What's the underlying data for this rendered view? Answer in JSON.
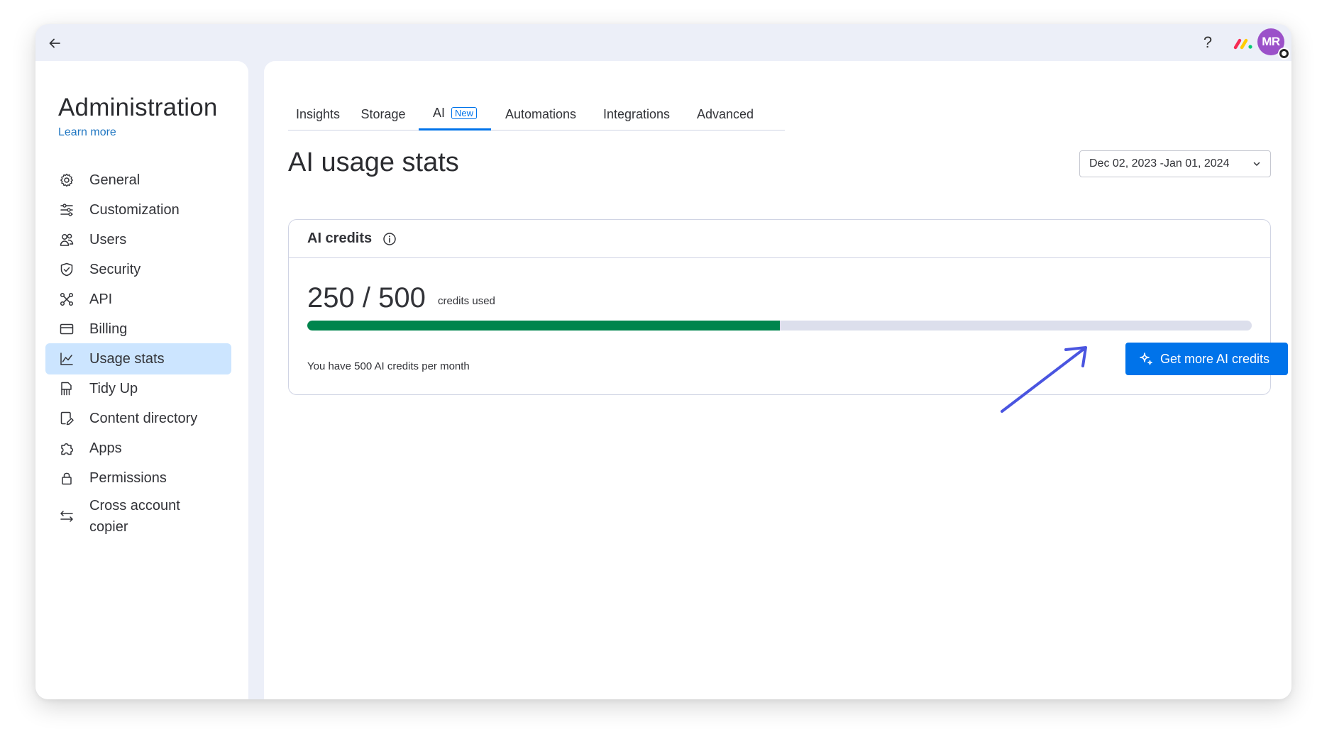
{
  "topbar": {
    "help_label": "?",
    "avatar_initials": "MR",
    "avatar_color": "#9b51c9"
  },
  "sidebar": {
    "title": "Administration",
    "learn_more": "Learn more",
    "items": [
      {
        "label": "General",
        "icon": "gear-icon"
      },
      {
        "label": "Customization",
        "icon": "sliders-icon"
      },
      {
        "label": "Users",
        "icon": "users-icon"
      },
      {
        "label": "Security",
        "icon": "shield-icon"
      },
      {
        "label": "API",
        "icon": "api-icon"
      },
      {
        "label": "Billing",
        "icon": "credit-card-icon"
      },
      {
        "label": "Usage stats",
        "icon": "chart-icon",
        "active": true
      },
      {
        "label": "Tidy Up",
        "icon": "broom-icon"
      },
      {
        "label": "Content directory",
        "icon": "document-edit-icon"
      },
      {
        "label": "Apps",
        "icon": "puzzle-icon"
      },
      {
        "label": "Permissions",
        "icon": "lock-icon"
      },
      {
        "label": "Cross account",
        "label_line2": "copier",
        "icon": "swap-arrows-icon"
      }
    ]
  },
  "tabs": [
    {
      "label": "Insights"
    },
    {
      "label": "Storage"
    },
    {
      "label": "AI",
      "badge": "New",
      "active": true
    },
    {
      "label": "Automations"
    },
    {
      "label": "Integrations"
    },
    {
      "label": "Advanced"
    }
  ],
  "main": {
    "page_title": "AI usage stats",
    "date_range": "Dec 02, 2023 -Jan 01, 2024"
  },
  "credits_card": {
    "title": "AI credits",
    "used_display": "250 / 500",
    "used": 250,
    "total": 500,
    "used_suffix": "credits used",
    "progress_fraction": 0.5,
    "monthly_note": "You have 500 AI credits per month",
    "button_label": "Get more AI credits"
  },
  "colors": {
    "accent": "#0073ea",
    "progress_fill": "#00854d",
    "progress_track": "#dcdfec",
    "active_nav": "#cce5ff",
    "annotation_arrow": "#4a55e0"
  }
}
